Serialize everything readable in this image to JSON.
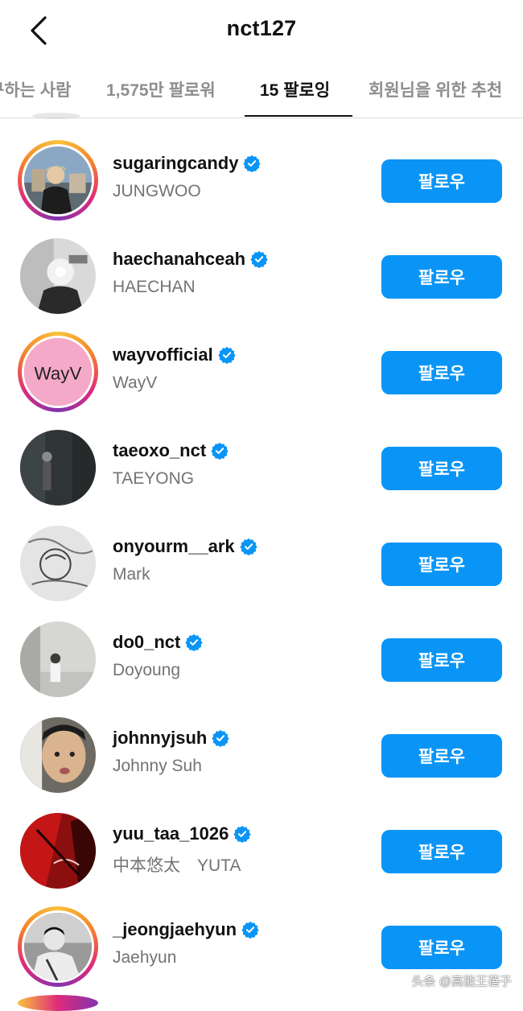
{
  "header": {
    "title": "nct127",
    "back_icon": "chevron-left-icon"
  },
  "tabs": [
    {
      "label": "구하는 사람",
      "active": false
    },
    {
      "label": "1,575만 팔로워",
      "active": false
    },
    {
      "label": "15 팔로잉",
      "active": true
    },
    {
      "label": "회원님을 위한 추천",
      "active": false
    }
  ],
  "colors": {
    "follow_button": "#0a95f6",
    "verified_badge": "#0a95f6",
    "secondary_text": "#737373"
  },
  "follow_label": "팔로우",
  "accounts": [
    {
      "username": "sugaringcandy",
      "name": "JUNGWOO",
      "story_ring": true
    },
    {
      "username": "haechanahceah",
      "name": "HAECHAN",
      "story_ring": false
    },
    {
      "username": "wayvofficial",
      "name": "WayV",
      "story_ring": true,
      "avatar_text": "WayV"
    },
    {
      "username": "taeoxo_nct",
      "name": "TAEYONG",
      "story_ring": false
    },
    {
      "username": "onyourm__ark",
      "name": "Mark",
      "story_ring": false
    },
    {
      "username": "do0_nct",
      "name": "Doyoung",
      "story_ring": false
    },
    {
      "username": "johnnyjsuh",
      "name": "Johnny Suh",
      "story_ring": false
    },
    {
      "username": "yuu_taa_1026",
      "name": "中本悠太　YUTA",
      "story_ring": false
    },
    {
      "username": "_jeongjaehyun",
      "name": "Jaehyun",
      "story_ring": true
    }
  ],
  "watermark": "头条 @高能王蓓子"
}
